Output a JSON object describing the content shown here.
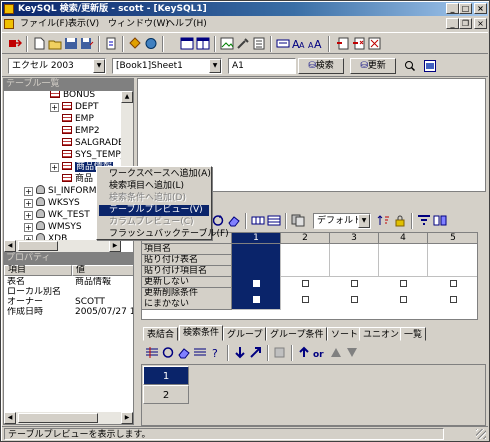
{
  "window": {
    "title": "KeySQL 検索/更新版 - scott - [KeySQL1]",
    "minimize": "_",
    "maximize": "□",
    "close": "×"
  },
  "menu": {
    "file": "ファイル(F)",
    "view": "表示(V)",
    "window": "ウィンドウ(W)",
    "help": "ヘルプ(H)"
  },
  "addressbar": {
    "excel_version": "エクセル 2003",
    "sheet": "[Book1]Sheet1",
    "cell": "A1",
    "search_button": "検索",
    "update_button": "更新"
  },
  "table_list": {
    "title": "テーブル一覧",
    "items": [
      {
        "label": "BONUS",
        "kind": "table"
      },
      {
        "label": "DEPT",
        "kind": "table",
        "expander": "+"
      },
      {
        "label": "EMP",
        "kind": "table"
      },
      {
        "label": "EMP2",
        "kind": "table"
      },
      {
        "label": "SALGRADE",
        "kind": "table"
      },
      {
        "label": "SYS_TEMP_",
        "kind": "table"
      },
      {
        "label": "商品情報",
        "kind": "table",
        "expander": "+",
        "selected": true
      },
      {
        "label": "商品",
        "kind": "table"
      },
      {
        "label": "SI_INFORMT",
        "kind": "user",
        "expander": "+"
      },
      {
        "label": "WKSYS",
        "kind": "user",
        "expander": "+"
      },
      {
        "label": "WK_TEST",
        "kind": "user",
        "expander": "+"
      },
      {
        "label": "WMSYS",
        "kind": "user",
        "expander": "+"
      },
      {
        "label": "XDB",
        "kind": "user",
        "expander": "+"
      }
    ]
  },
  "context_menu": {
    "items": [
      {
        "label": "ワークスペースへ追加(A)",
        "state": "normal"
      },
      {
        "label": "検索項目へ追加(L)",
        "state": "normal"
      },
      {
        "label": "検索条件へ追加(D)",
        "state": "disabled"
      },
      {
        "label": "テーブルプレビュー(V)",
        "state": "highlighted"
      },
      {
        "label": "カラムプレビュー(C)",
        "state": "disabled"
      },
      {
        "label": "フラッシュバックテーブル(F)",
        "state": "normal"
      }
    ]
  },
  "properties": {
    "title": "プロパティ",
    "col_item": "項目",
    "col_value": "値",
    "rows": [
      {
        "item": "表名",
        "value": "商品情報"
      },
      {
        "item": "ローカル別名",
        "value": ""
      },
      {
        "item": "オーナー",
        "value": "SCOTT"
      },
      {
        "item": "作成日時",
        "value": "2005/07/27 14"
      }
    ]
  },
  "grid_toolbar": {
    "default_combo": "デフォルト"
  },
  "field_grid": {
    "columns": [
      "1",
      "2",
      "3",
      "4",
      "5"
    ],
    "rows": [
      {
        "label": "項目名"
      },
      {
        "label": "貼り付け表名"
      },
      {
        "label": "貼り付け項目名"
      },
      {
        "label": "更新しない"
      },
      {
        "label": "更新削除条件"
      },
      {
        "label": "にまかない"
      }
    ]
  },
  "tabs": [
    {
      "label": "表結合",
      "active": false
    },
    {
      "label": "検索条件",
      "active": true
    },
    {
      "label": "グループ",
      "active": false
    },
    {
      "label": "グループ条件",
      "active": false
    },
    {
      "label": "ソート",
      "active": false
    },
    {
      "label": "ユニオン",
      "active": false
    },
    {
      "label": "一覧",
      "active": false
    }
  ],
  "condition_grid": {
    "rows": [
      "1",
      "2"
    ]
  },
  "status": {
    "text": "テーブルプレビューを表示します。"
  },
  "colors": {
    "selection": "#0a246a",
    "face": "#d4d0c8"
  }
}
